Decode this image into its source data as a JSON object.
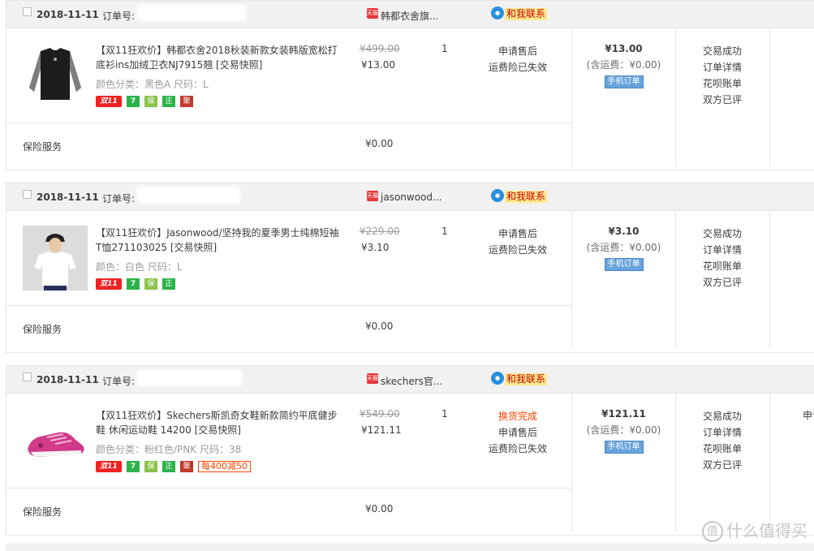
{
  "orders": [
    {
      "date": "2018-11-11",
      "order_label": "订单号:",
      "shop": "韩都衣舍旗...",
      "contact": "和我联系",
      "title": "【双11狂欢价】韩都衣舍2018秋装新款女装韩版宽松打底衫ins加绒卫衣NJ7915翘 [交易快照]",
      "attrs": "颜色分类：黑色A   尺码：L",
      "orig_price": "¥499.00",
      "price": "¥13.00",
      "qty": "1",
      "aftersale_highlight": "",
      "aftersale": [
        "申请售后",
        "运费险已失效"
      ],
      "tags": [
        "双11",
        "7",
        "保",
        "正",
        "聚"
      ],
      "promo": "",
      "service_label": "保险服务",
      "service_price": "¥0.00",
      "total": "¥13.00",
      "shipping": "(含运费：¥0.00)",
      "mobile": "手机订单",
      "status": [
        "交易成功",
        "订单详情",
        "花呗账单",
        "双方已评"
      ],
      "op": ""
    },
    {
      "date": "2018-11-11",
      "order_label": "订单号:",
      "shop": "jasonwood...",
      "contact": "和我联系",
      "title": "【双11狂欢价】Jasonwood/坚持我的夏季男士纯棉短袖T恤271103025 [交易快照]",
      "attrs": "颜色：白色   尺码：L",
      "orig_price": "¥229.00",
      "price": "¥3.10",
      "qty": "1",
      "aftersale_highlight": "",
      "aftersale": [
        "申请售后",
        "运费险已失效"
      ],
      "tags": [
        "双11",
        "7",
        "保",
        "正"
      ],
      "promo": "",
      "service_label": "保险服务",
      "service_price": "¥0.00",
      "total": "¥3.10",
      "shipping": "(含运费：¥0.00)",
      "mobile": "手机订单",
      "status": [
        "交易成功",
        "订单详情",
        "花呗账单",
        "双方已评"
      ],
      "op": ""
    },
    {
      "date": "2018-11-11",
      "order_label": "订单号:",
      "shop": "skechers官...",
      "contact": "和我联系",
      "title": "【双11狂欢价】Skechers斯凯奇女鞋新款简约平底健步鞋 休闲运动鞋 14200 [交易快照]",
      "attrs": "颜色分类：粉红色/PNK   尺码：38",
      "orig_price": "¥549.00",
      "price": "¥121.11",
      "qty": "1",
      "aftersale_highlight": "换货完成",
      "aftersale": [
        "申请售后",
        "运费险已失效"
      ],
      "tags": [
        "双11",
        "7",
        "保",
        "正",
        "聚"
      ],
      "promo": "每400减50",
      "service_label": "保险服务",
      "service_price": "¥0.00",
      "total": "¥121.11",
      "shipping": "(含运费：¥0.00)",
      "mobile": "手机订单",
      "status": [
        "交易成功",
        "订单详情",
        "花呗账单",
        "双方已评"
      ],
      "op": "申请"
    }
  ],
  "tmall_icon_text": "天猫",
  "watermark": "什么值得买"
}
